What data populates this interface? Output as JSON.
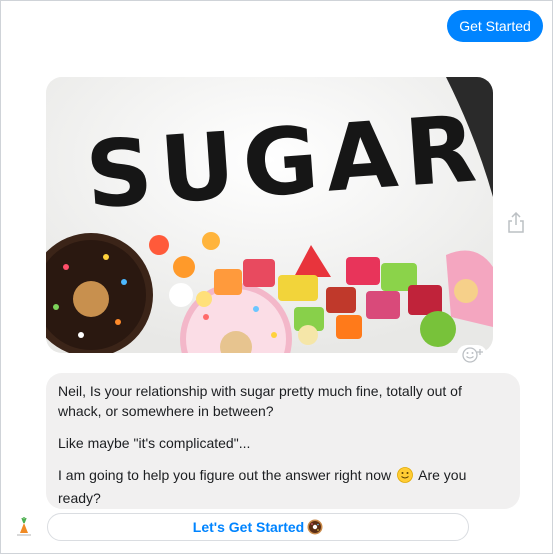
{
  "header": {
    "get_started_label": "Get Started"
  },
  "card": {
    "image_text": "SUGAR",
    "image_alt": "Sugar written in white sugar above donuts and candies"
  },
  "message": {
    "paragraph_1": "Neil, Is your relationship with sugar pretty much fine, totally out of whack, or somewhere in between?",
    "paragraph_2": "Like maybe \"it's complicated\"...",
    "paragraph_3_start": "I am going to help you figure out the answer right now",
    "paragraph_3_end": "Are you ready?"
  },
  "quick_reply": {
    "label": "Let's Get Started"
  },
  "icons": {
    "share": "share-icon",
    "reaction": "emoji-reaction-icon",
    "smile": "slightly-smiling-face-icon",
    "donut": "donut-icon",
    "logo": "carrot-logo-icon"
  },
  "colors": {
    "accent": "#0084ff",
    "bubble": "#f1f0f0"
  }
}
